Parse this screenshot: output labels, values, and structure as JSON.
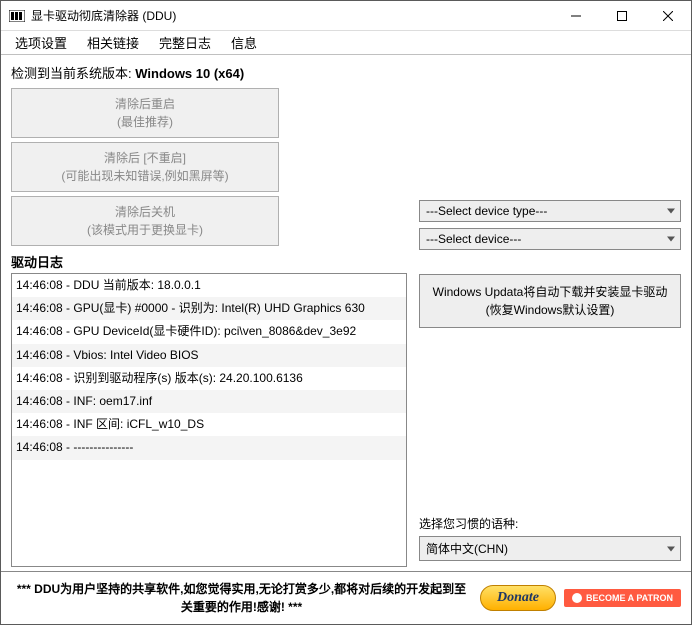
{
  "titlebar": {
    "title": "显卡驱动彻底清除器 (DDU)"
  },
  "menubar": {
    "options": "选项设置",
    "links": "相关链接",
    "log": "完整日志",
    "info": "信息"
  },
  "sysVersion": {
    "prefix": "检测到当前系统版本: ",
    "value": "Windows 10 (x64)"
  },
  "actions": {
    "cleanRestart": {
      "line1": "清除后重启",
      "line2": "(最佳推荐)"
    },
    "cleanNoRestart": {
      "line1": "清除后 [不重启]",
      "line2": "(可能出现未知错误,例如黑屏等)"
    },
    "cleanShutdown": {
      "line1": "清除后关机",
      "line2": "(该模式用于更换显卡)"
    }
  },
  "logHeader": "驱动日志",
  "logs": [
    "14:46:08 - DDU 当前版本: 18.0.0.1",
    "14:46:08 - GPU(显卡) #0000 - 识别为: Intel(R) UHD Graphics 630",
    "14:46:08 - GPU DeviceId(显卡硬件ID): pci\\ven_8086&dev_3e92",
    "14:46:08 - Vbios: Intel Video BIOS",
    "14:46:08 - 识别到驱动程序(s) 版本(s): 24.20.100.6136",
    "14:46:08 - INF: oem17.inf",
    "14:46:08 - INF 区间: iCFL_w10_DS",
    "14:46:08 - ---------------"
  ],
  "right": {
    "deviceType": "---Select device type---",
    "device": "---Select device---",
    "restore": {
      "line1": "Windows Updata将自动下载并安装显卡驱动",
      "line2": "(恢复Windows默认设置)"
    },
    "langLabel": "选择您习惯的语种:",
    "langValue": "简体中文(CHN)"
  },
  "footer": {
    "text": "*** DDU为用户坚持的共享软件,如您觉得实用,无论打赏多少,都将对后续的开发起到至关重要的作用!感谢! ***",
    "donate": "Donate",
    "patron": "BECOME A PATRON"
  }
}
